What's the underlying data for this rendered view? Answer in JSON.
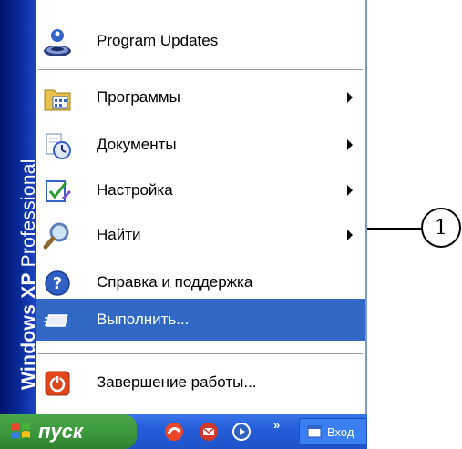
{
  "start_menu": {
    "side_band": {
      "brand_bold": "Windows XP",
      "brand_light": "Professional"
    },
    "items": [
      {
        "label": "Program Updates",
        "icon": "program-updates-icon",
        "has_submenu": false
      },
      {
        "label": "Программы",
        "icon": "programs-folder-icon",
        "has_submenu": true
      },
      {
        "label": "Документы",
        "icon": "documents-icon",
        "has_submenu": true
      },
      {
        "label": "Настройка",
        "icon": "settings-icon",
        "has_submenu": true
      },
      {
        "label": "Найти",
        "icon": "search-icon",
        "has_submenu": true
      },
      {
        "label": "Справка и поддержка",
        "icon": "help-icon",
        "has_submenu": false
      },
      {
        "label": "Выполнить...",
        "icon": "run-icon",
        "has_submenu": false,
        "selected": true
      },
      {
        "label": "Завершение работы...",
        "icon": "shutdown-icon",
        "has_submenu": false
      }
    ]
  },
  "taskbar": {
    "start_label": "пуск",
    "quick_launch_icons": [
      "browser-icon",
      "email-icon",
      "media-player-icon"
    ],
    "overflow_chevron": "»",
    "task_button_label": "Вход"
  },
  "callout": {
    "number": "1"
  },
  "colors": {
    "selected": "#3168c6",
    "side_band": "#0a2b9a",
    "taskbar": "#245edb",
    "start_button": "#3b9a3b"
  }
}
